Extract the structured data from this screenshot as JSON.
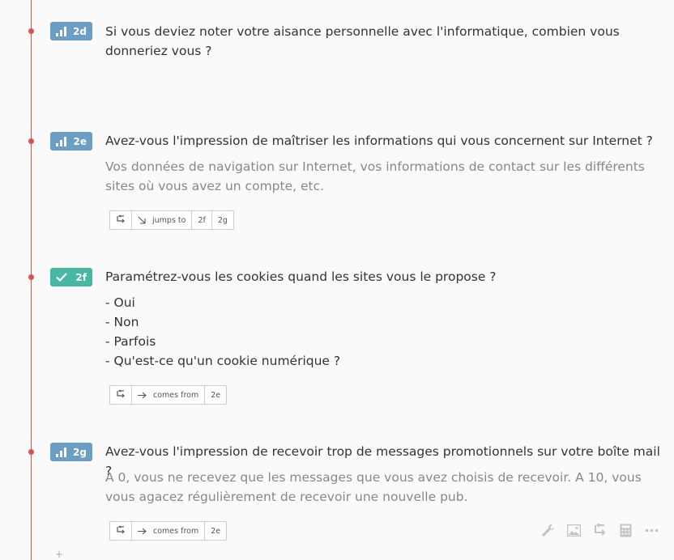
{
  "questions": [
    {
      "id": "2d",
      "type_icon": "bar-chart-icon",
      "text": "Si vous deviez noter votre aisance personnelle avec l'informatique, combien vous donneriez vous ?"
    },
    {
      "id": "2e",
      "type_icon": "bar-chart-icon",
      "text": "Avez-vous l'impression de maîtriser les informations qui vous concernent sur Internet ?",
      "description": "Vos données de navigation sur Internet, vos informations de contact sur les différents sites où vous avez un compte, etc.",
      "logic": {
        "relation": "jumps to",
        "targets": [
          "2f",
          "2g"
        ]
      }
    },
    {
      "id": "2f",
      "type_icon": "checkmark-icon",
      "text": "Paramétrez-vous les cookies quand les sites vous le propose ?",
      "choices": [
        "- Oui",
        "- Non",
        "- Parfois",
        "- Qu'est-ce qu'un cookie numérique ?"
      ],
      "logic": {
        "relation": "comes from",
        "targets": [
          "2e"
        ]
      }
    },
    {
      "id": "2g",
      "type_icon": "bar-chart-icon",
      "text": "Avez-vous l'impression de recevoir trop de messages promotionnels sur votre boîte mail ?",
      "description": "A 0, vous ne recevez que les messages que vous avez choisis de recevoir. A 10, vous vous agacez régulièrement de recevoir une nouvelle pub.",
      "logic": {
        "relation": "comes from",
        "targets": [
          "2e"
        ]
      }
    }
  ],
  "toolbar_icons": [
    "wrench-icon",
    "image-icon",
    "logic-icon",
    "calculator-icon",
    "more-icon"
  ],
  "add_label": "+",
  "colors": {
    "timeline": "#d9534f",
    "badge_rating": "#6a9ec5",
    "badge_choice": "#48b7a3"
  }
}
